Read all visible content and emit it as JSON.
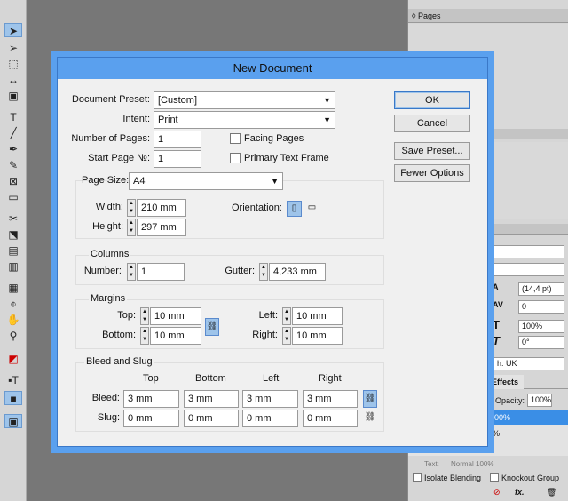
{
  "dialog": {
    "title": "New Document",
    "document_preset_label": "Document Preset:",
    "document_preset_value": "[Custom]",
    "intent_label": "Intent:",
    "intent_value": "Print",
    "number_of_pages_label": "Number of Pages:",
    "number_of_pages_value": "1",
    "start_page_label": "Start Page №:",
    "start_page_value": "1",
    "facing_pages_label": "Facing Pages",
    "facing_pages_checked": false,
    "primary_text_frame_label": "Primary Text Frame",
    "primary_text_frame_checked": false,
    "page_size_label": "Page Size:",
    "page_size_value": "A4",
    "width_label": "Width:",
    "width_value": "210 mm",
    "height_label": "Height:",
    "height_value": "297 mm",
    "orientation_label": "Orientation:",
    "columns_title": "Columns",
    "number_label": "Number:",
    "number_value": "1",
    "gutter_label": "Gutter:",
    "gutter_value": "4,233 mm",
    "margins_title": "Margins",
    "top_label": "Top:",
    "top_value": "10 mm",
    "bottom_label": "Bottom:",
    "bottom_value": "10 mm",
    "left_label": "Left:",
    "left_value": "10 mm",
    "right_label": "Right:",
    "right_value": "10 mm",
    "bleed_slug_title": "Bleed and Slug",
    "bs_col_top": "Top",
    "bs_col_bottom": "Bottom",
    "bs_col_left": "Left",
    "bs_col_right": "Right",
    "bleed_label": "Bleed:",
    "bleed_top": "3 mm",
    "bleed_bottom": "3 mm",
    "bleed_left": "3 mm",
    "bleed_right": "3 mm",
    "slug_label": "Slug:",
    "slug_top": "0 mm",
    "slug_bottom": "0 mm",
    "slug_left": "0 mm",
    "slug_right": "0 mm",
    "ok_label": "OK",
    "cancel_label": "Cancel",
    "save_preset_label": "Save Preset...",
    "fewer_options_label": "Fewer Options"
  },
  "panels": {
    "pages_title": "Pages",
    "leading_value": "(14,4 pt)",
    "tracking_value": "0",
    "horizontal_scale_value": "100%",
    "skew_value": "0°",
    "language_value": "h: UK",
    "effects_tab": "Effects",
    "opacity_label": "Opacity:",
    "opacity_value": "100%",
    "effects_row1": "100%",
    "effects_row2": "0%",
    "effects_row3": "Normal 100%",
    "text_label": "Text:",
    "text_value": "Normal 100%",
    "isolate_blending_label": "Isolate Blending",
    "knockout_group_label": "Knockout Group"
  },
  "colors": {
    "dialog_accent": "#5aa0ee",
    "workspace": "#777777",
    "selection": "#9ec4ea",
    "effects_highlight": "#3a8ee6"
  }
}
